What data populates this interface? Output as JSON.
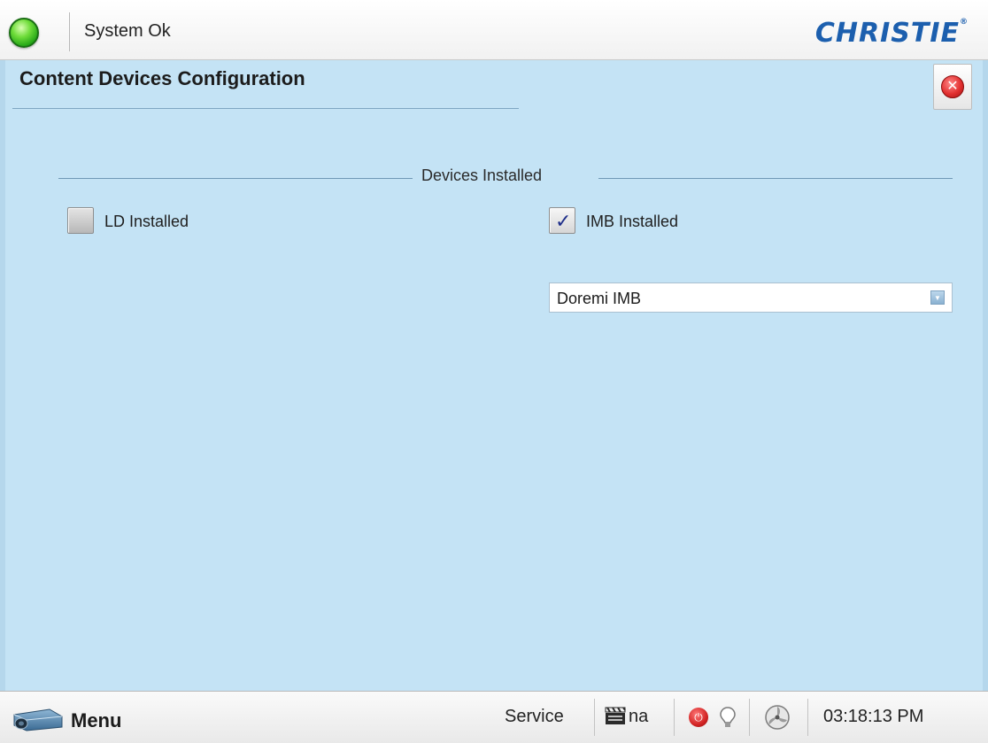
{
  "header": {
    "status_text": "System Ok",
    "status_color": "#2fbf1e",
    "logo_text": "CHRISTIE",
    "logo_mark": "®",
    "brand_color": "#1c5fae"
  },
  "page": {
    "title": "Content Devices Configuration",
    "close_icon": "close-icon",
    "close_glyph": "✕"
  },
  "section": {
    "label": "Devices Installed"
  },
  "devices": {
    "ld": {
      "label": "LD Installed",
      "checked": false
    },
    "imb": {
      "label": "IMB Installed",
      "checked": true,
      "check_glyph": "✓"
    },
    "imb_type": {
      "selected": "Doremi IMB",
      "arrow_glyph": "▼"
    }
  },
  "footer": {
    "menu_label": "Menu",
    "service_label": "Service",
    "content_status": "na",
    "power_glyph": "⏻",
    "time": "03:18:13 PM"
  }
}
